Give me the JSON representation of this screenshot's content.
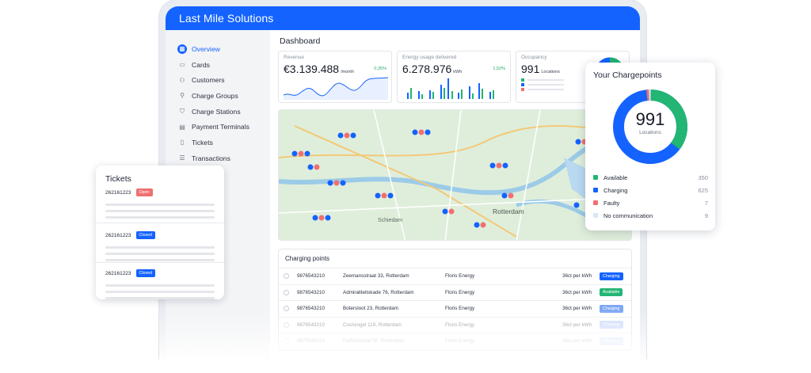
{
  "app": {
    "title": "Last Mile Solutions"
  },
  "sidebar": {
    "items": [
      {
        "label": "Overview",
        "icon": "grid-icon",
        "active": true
      },
      {
        "label": "Cards",
        "icon": "card-icon"
      },
      {
        "label": "Customers",
        "icon": "users-icon"
      },
      {
        "label": "Charge Groups",
        "icon": "group-icon"
      },
      {
        "label": "Charge Stations",
        "icon": "station-icon"
      },
      {
        "label": "Payment Terminals",
        "icon": "terminal-icon"
      },
      {
        "label": "Tickets",
        "icon": "ticket-icon"
      },
      {
        "label": "Transactions",
        "icon": "list-icon"
      }
    ]
  },
  "dashboard": {
    "title": "Dashboard",
    "revenue": {
      "label": "Revenue",
      "value": "€3.139.488",
      "unit": "/month",
      "delta": "0,35%"
    },
    "energy": {
      "label": "Energy usage delivered",
      "value": "6.278.976",
      "unit": "kWh",
      "delta": "1,52%"
    },
    "occupancy": {
      "label": "Occupancy",
      "value": "991",
      "unit": "Locations"
    }
  },
  "map": {
    "labels": [
      "Schiedam",
      "Rotterdam"
    ]
  },
  "table": {
    "title": "Charging points",
    "rows": [
      {
        "id": "9876543210",
        "address": "Zeemansstraat 33, Rotterdam",
        "company": "Floris Energy",
        "price": "36ct per kWh",
        "status": "Charging"
      },
      {
        "id": "9876543210",
        "address": "Admiraliteitskade 76, Rotterdam",
        "company": "Floris Energy",
        "price": "36ct per kWh",
        "status": "Available"
      },
      {
        "id": "9876543210",
        "address": "Botersloot 23, Rotterdam",
        "company": "Floris Energy",
        "price": "36ct per kWh",
        "status": "Charging"
      },
      {
        "id": "9876543210",
        "address": "Coolsingel 119, Rotterdam",
        "company": "Floris Energy",
        "price": "36ct per kWh",
        "status": "Charging"
      },
      {
        "id": "9876543210",
        "address": "Delftsestraat 38, Rotterdam",
        "company": "Floris Energy",
        "price": "36ct per kWh",
        "status": "Charging"
      }
    ]
  },
  "tickets": {
    "title": "Tickets",
    "items": [
      {
        "id": "262161223",
        "status": "Open"
      },
      {
        "id": "262161223",
        "status": "Closed"
      },
      {
        "id": "262161223",
        "status": "Closed"
      }
    ]
  },
  "chargepoints": {
    "title": "Your Chargepoints",
    "total": "991",
    "total_label": "Locations",
    "legend": [
      {
        "label": "Available",
        "count": "350",
        "color": "#22b573"
      },
      {
        "label": "Charging",
        "count": "625",
        "color": "#1463ff"
      },
      {
        "label": "Faulty",
        "count": "7",
        "color": "#f07070"
      },
      {
        "label": "No communication",
        "count": "9",
        "color": "#dbe6f5"
      }
    ]
  },
  "colors": {
    "accent": "#1463ff",
    "available": "#22b573",
    "open": "#f07070"
  }
}
